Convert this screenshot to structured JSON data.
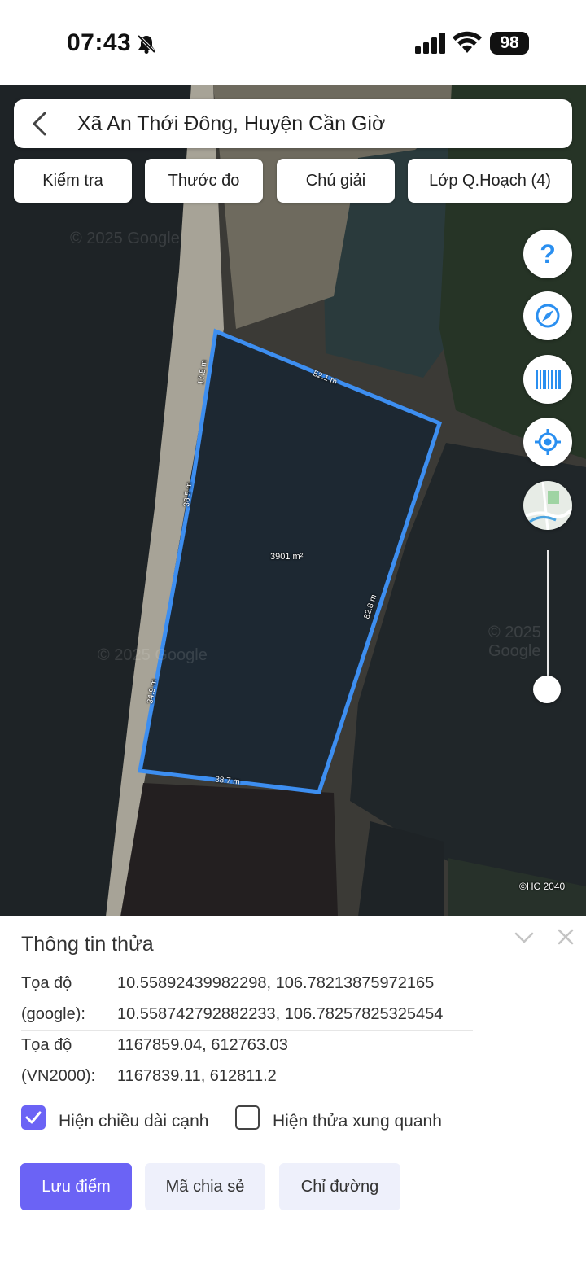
{
  "status_bar": {
    "time": "07:43",
    "battery": "98",
    "icons": [
      "bell-muted-icon",
      "signal-icon",
      "wifi-icon",
      "battery-icon"
    ]
  },
  "search": {
    "location": "Xã An Thới Đông, Huyện Cần Giờ"
  },
  "toolbar": {
    "check": "Kiểm tra",
    "ruler": "Thước đo",
    "legend": "Chú giải",
    "layers": "Lớp Q.Hoạch (4)"
  },
  "map": {
    "parcel_area": "3901 m²",
    "edges": {
      "e1": "17.5 m",
      "e2": "52.1 m",
      "e3": "82.8 m",
      "e4": "38.7 m",
      "e5": "34.9 m",
      "e6": "36.5 m"
    },
    "watermark": "© 2025 Google",
    "copyright": "©HC 2040",
    "parcel_color": "#3d8ef0",
    "zoom_level": 0.0
  },
  "panel": {
    "title": "Thông tin thửa",
    "google_label_1": "Tọa độ",
    "google_label_2": "(google):",
    "google_value_1": "10.55892439982298, 106.78213875972165",
    "google_value_2": "10.558742792882233, 106.78257825325454",
    "vn_label_1": "Tọa độ",
    "vn_label_2": "(VN2000):",
    "vn_value_1": "1167859.04, 612763.03",
    "vn_value_2": "1167839.11, 612811.2",
    "show_edges_label": "Hiện chiều dài cạnh",
    "show_edges_checked": true,
    "show_neighbors_label": "Hiện thửa xung quanh",
    "show_neighbors_checked": false,
    "save_point": "Lưu điểm",
    "share_code": "Mã chia sẻ",
    "directions": "Chỉ đường"
  },
  "colors": {
    "accent": "#6b63f5",
    "secondary_button": "#eef0fb"
  }
}
